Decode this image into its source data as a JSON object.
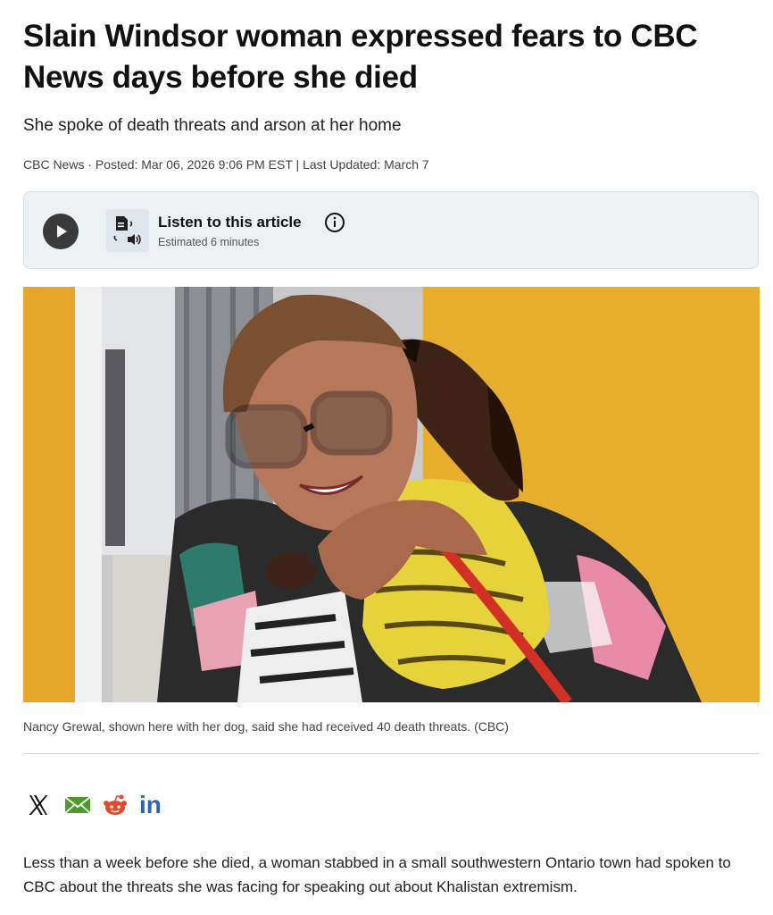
{
  "article": {
    "headline": "Slain Windsor woman expressed fears to CBC News days before she died",
    "subhead": "She spoke of death threats and arson at her home",
    "byline": "CBC News · Posted: Mar 06, 2026 9:06 PM EST | Last Updated: March 7",
    "caption": "Nancy Grewal, shown here with her dog, said she had received 40 death threats. (CBC)",
    "body": "Less than a week before she died, a woman stabbed in a small southwestern Ontario town had spoken to CBC about the threats she was facing for speaking out about Khalistan extremism."
  },
  "listen": {
    "title": "Listen to this article",
    "estimate": "Estimated 6 minutes",
    "play_icon": "play-icon",
    "info_icon": "info-icon"
  },
  "share": {
    "icons": [
      "x-icon",
      "email-icon",
      "reddit-icon",
      "linkedin-icon"
    ],
    "linkedin_text": "in"
  },
  "colors": {
    "wall": "#e9b233",
    "listen_bg": "#eef1f4",
    "email_green": "#4c9a2a",
    "reddit_red": "#e24a2b",
    "linkedin_blue": "#2867b2"
  }
}
